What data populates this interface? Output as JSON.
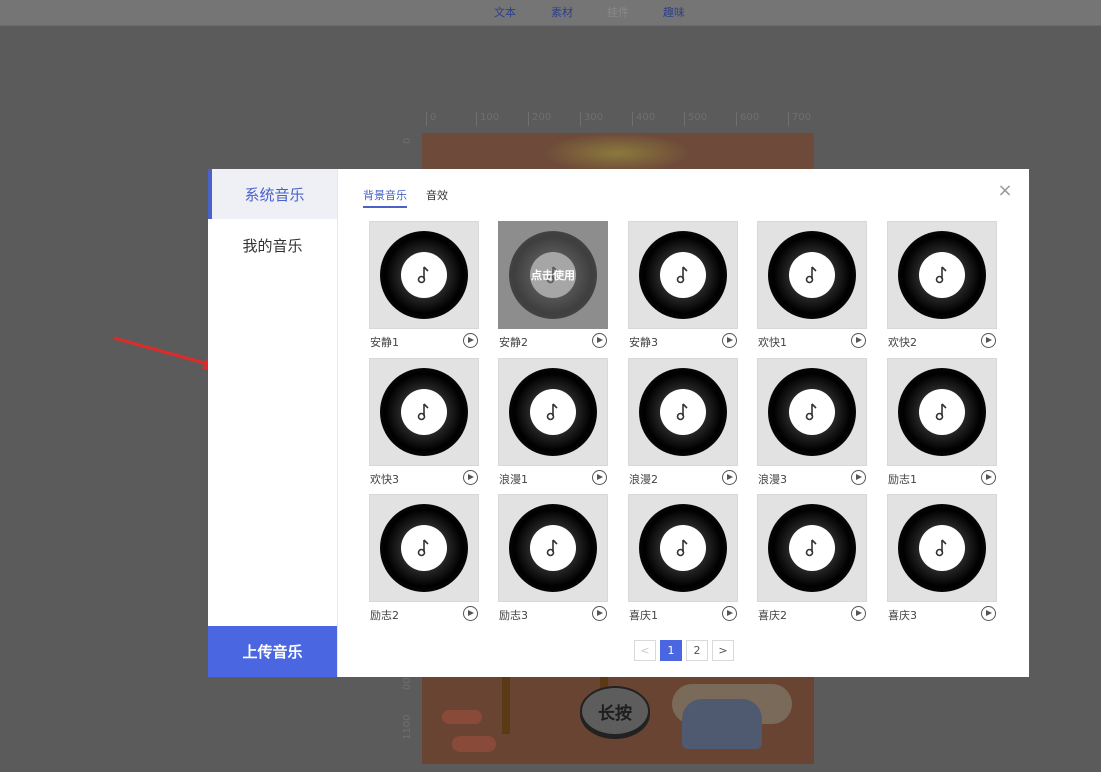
{
  "toolbar": {
    "items": [
      {
        "label": "文本"
      },
      {
        "label": "素材"
      },
      {
        "label": "挂件"
      },
      {
        "label": "趣味"
      }
    ]
  },
  "canvas": {
    "ruler_top": [
      "0",
      "100",
      "200",
      "300",
      "400",
      "500",
      "600",
      "700"
    ],
    "ruler_left": [
      "0",
      "00",
      "1100"
    ],
    "press_label": "长按"
  },
  "modal": {
    "sidebar": {
      "items": [
        {
          "label": "系统音乐",
          "active": true
        },
        {
          "label": "我的音乐",
          "active": false
        }
      ],
      "upload_label": "上传音乐"
    },
    "tabs": [
      {
        "label": "背景音乐",
        "active": true
      },
      {
        "label": "音效",
        "active": false
      }
    ],
    "close_icon": "close-icon",
    "hover_text": "点击使用",
    "tracks": [
      {
        "name": "安静1"
      },
      {
        "name": "安静2"
      },
      {
        "name": "安静3"
      },
      {
        "name": "欢快1"
      },
      {
        "name": "欢快2"
      },
      {
        "name": "欢快3"
      },
      {
        "name": "浪漫1"
      },
      {
        "name": "浪漫2"
      },
      {
        "name": "浪漫3"
      },
      {
        "name": "励志1"
      },
      {
        "name": "励志2"
      },
      {
        "name": "励志3"
      },
      {
        "name": "喜庆1"
      },
      {
        "name": "喜庆2"
      },
      {
        "name": "喜庆3"
      }
    ],
    "pagination": {
      "prev": "<",
      "pages": [
        "1",
        "2"
      ],
      "current": "1",
      "next": ">"
    }
  },
  "colors": {
    "accent": "#4a66e0",
    "arrow": "#e02a2a"
  }
}
